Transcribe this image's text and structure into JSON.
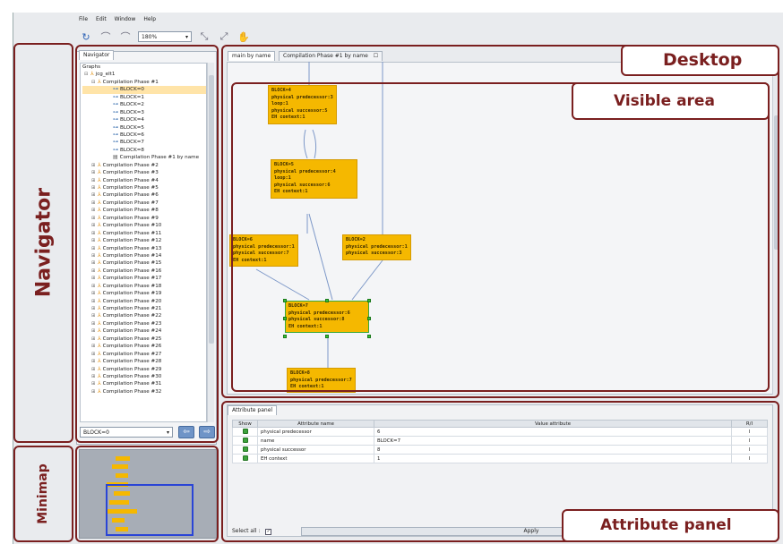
{
  "menu": [
    "File",
    "Edit",
    "Window",
    "Help"
  ],
  "toolbar": {
    "zoom": "180%"
  },
  "navigator": {
    "tab": "Navigator",
    "root": "Graphs",
    "graph": "jcg_elt1",
    "phase1": "Compilation Phase #1",
    "blocks": [
      "BLOCK=0",
      "BLOCK=1",
      "BLOCK=2",
      "BLOCK=3",
      "BLOCK=4",
      "BLOCK=5",
      "BLOCK=6",
      "BLOCK=7",
      "BLOCK=8"
    ],
    "phase1_doc": "Compilation Phase #1 by name",
    "phases": [
      "Compilation Phase #2",
      "Compilation Phase #3",
      "Compilation Phase #4",
      "Compilation Phase #5",
      "Compilation Phase #6",
      "Compilation Phase #7",
      "Compilation Phase #8",
      "Compilation Phase #9",
      "Compilation Phase #10",
      "Compilation Phase #11",
      "Compilation Phase #12",
      "Compilation Phase #13",
      "Compilation Phase #14",
      "Compilation Phase #15",
      "Compilation Phase #16",
      "Compilation Phase #17",
      "Compilation Phase #18",
      "Compilation Phase #19",
      "Compilation Phase #20",
      "Compilation Phase #21",
      "Compilation Phase #22",
      "Compilation Phase #23",
      "Compilation Phase #24",
      "Compilation Phase #25",
      "Compilation Phase #26",
      "Compilation Phase #27",
      "Compilation Phase #28",
      "Compilation Phase #29",
      "Compilation Phase #30",
      "Compilation Phase #31",
      "Compilation Phase #32"
    ],
    "combo_value": "BLOCK=0"
  },
  "desktop": {
    "tabs": [
      "main by name",
      "Compilation Phase #1 by name"
    ],
    "nodes": {
      "n4": [
        "BLOCK=4",
        "physical predecessor:3",
        "loop:1",
        "physical successor:5",
        "EH context:1"
      ],
      "n5": [
        "BLOCK=5",
        "physical predecessor:4",
        "loop:1",
        "physical successor:6",
        "EH context:1"
      ],
      "n6": [
        "BLOCK=6",
        "physical predecessor:1",
        "physical successor:7",
        "EH context:1"
      ],
      "n2": [
        "BLOCK=2",
        "physical predecessor:1",
        "physical successor:3"
      ],
      "n7": [
        "BLOCK=7",
        "physical predecessor:6",
        "physical successor:8",
        "EH context:1"
      ],
      "n8": [
        "BLOCK=8",
        "physical predecessor:7",
        "EH context:1"
      ]
    }
  },
  "attribute_panel": {
    "tab": "Attribute panel",
    "headers": [
      "Show",
      "Attribute name",
      "Value attribute",
      "R/I"
    ],
    "rows": [
      {
        "name": "physical predecessor",
        "value": "6",
        "ri": "I"
      },
      {
        "name": "name",
        "value": "BLOCK=7",
        "ri": "I"
      },
      {
        "name": "physical successor",
        "value": "8",
        "ri": "I"
      },
      {
        "name": "EH context",
        "value": "1",
        "ri": "I"
      }
    ],
    "select_all": "Select all :",
    "apply": "Apply"
  },
  "annotations": {
    "navigator": "Navigator",
    "minimap": "Minimap",
    "desktop": "Desktop",
    "visible_area": "Visible area",
    "attribute_panel": "Attribute panel"
  },
  "colors": {
    "annotation": "#7a1f1f",
    "node": "#f5b800",
    "selection": "#ffe4a8"
  }
}
